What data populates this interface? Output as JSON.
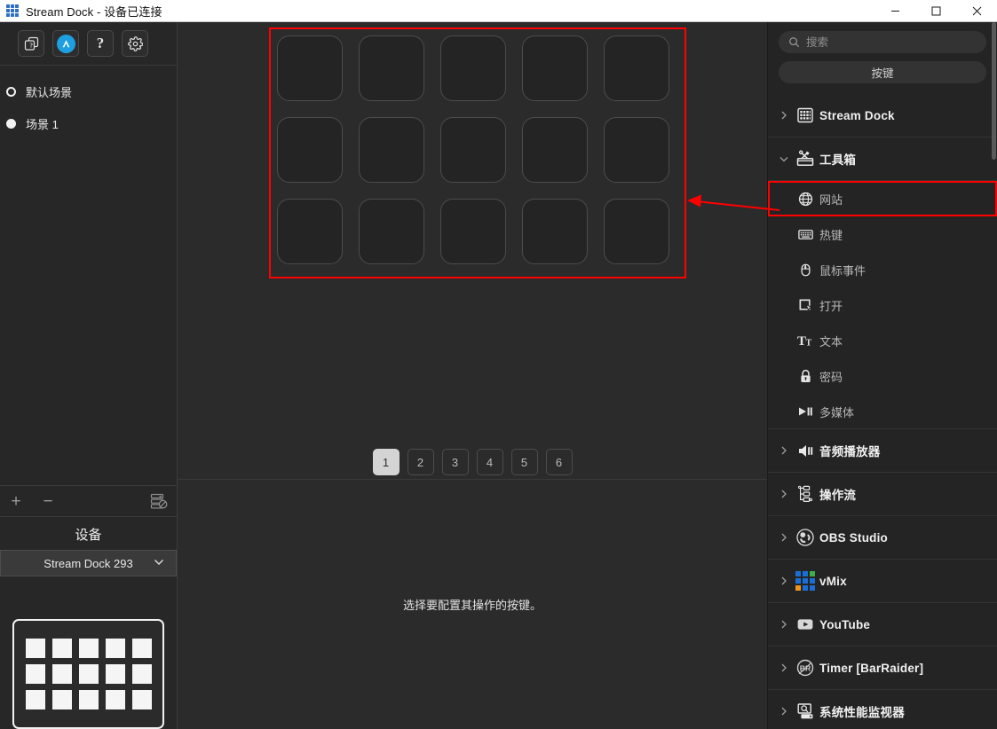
{
  "window": {
    "title": "Stream Dock - 设备已连接",
    "logo_icon": "app-grid-icon",
    "minimize_icon": "minimize-icon",
    "maximize_icon": "maximize-icon",
    "close_icon": "close-icon"
  },
  "toolbar": {
    "buttons": [
      {
        "name": "profiles-button",
        "icon": "stacked-cards-icon",
        "label": ""
      },
      {
        "name": "brand-button",
        "icon": "brand-logo-icon",
        "label": ""
      },
      {
        "name": "help-button",
        "icon": "question-mark-icon",
        "label": "?"
      },
      {
        "name": "settings-button",
        "icon": "gear-icon",
        "label": ""
      }
    ]
  },
  "scenes": {
    "items": [
      {
        "label": "默认场景",
        "selected": true,
        "marker": "ring"
      },
      {
        "label": "场景 1",
        "selected": false,
        "marker": "solid"
      }
    ],
    "actions": {
      "add_label": "+",
      "remove_label": "−",
      "manage_icon": "device-list-icon"
    }
  },
  "device": {
    "heading": "设备",
    "selected": "Stream Dock 293",
    "chevron_icon": "chevron-down-icon",
    "preview_icon": "device-keypad-preview",
    "preview_rows": 3,
    "preview_cols": 5
  },
  "canvas": {
    "grid_rows": 3,
    "grid_cols": 5,
    "keys_total": 15,
    "annotation": {
      "box_color": "#fe0000",
      "arrow_color": "#fe0000",
      "arrow_icon": "left-arrow-annotation"
    },
    "pages": [
      "1",
      "2",
      "3",
      "4",
      "5",
      "6"
    ],
    "active_page": "1",
    "hint": "选择要配置其操作的按键。"
  },
  "right_panel": {
    "search": {
      "placeholder": "搜索",
      "value": "",
      "icon": "search-icon"
    },
    "keys_button": "按键",
    "scrollbar_icon": "vertical-scrollbar",
    "categories": [
      {
        "label": "Stream Dock",
        "icon": "stream-dock-keypad-icon",
        "expanded": false,
        "chevron": "chevron-right-icon",
        "children": []
      },
      {
        "label": "工具箱",
        "icon": "toolbox-icon",
        "expanded": true,
        "chevron": "chevron-down-icon",
        "children": [
          {
            "label": "网站",
            "icon": "globe-icon",
            "selected": true
          },
          {
            "label": "热键",
            "icon": "keyboard-icon",
            "selected": false
          },
          {
            "label": "鼠标事件",
            "icon": "mouse-icon",
            "selected": false
          },
          {
            "label": "打开",
            "icon": "open-cursor-icon",
            "selected": false
          },
          {
            "label": "文本",
            "icon": "text-tt-icon",
            "selected": false
          },
          {
            "label": "密码",
            "icon": "lock-icon",
            "selected": false
          },
          {
            "label": "多媒体",
            "icon": "play-pause-icon",
            "selected": false
          }
        ]
      },
      {
        "label": "音频播放器",
        "icon": "speaker-icon",
        "expanded": false,
        "chevron": "chevron-right-icon",
        "children": []
      },
      {
        "label": "操作流",
        "icon": "workflow-nodes-icon",
        "expanded": false,
        "chevron": "chevron-right-icon",
        "children": []
      },
      {
        "label": "OBS Studio",
        "icon": "obs-studio-icon",
        "expanded": false,
        "chevron": "chevron-right-icon",
        "children": []
      },
      {
        "label": "vMix",
        "icon": "vmix-grid-icon",
        "expanded": false,
        "chevron": "chevron-right-icon",
        "children": []
      },
      {
        "label": "YouTube",
        "icon": "youtube-icon",
        "expanded": false,
        "chevron": "chevron-right-icon",
        "children": []
      },
      {
        "label": "Timer [BarRaider]",
        "icon": "barraider-icon",
        "expanded": false,
        "chevron": "chevron-right-icon",
        "children": []
      },
      {
        "label": "系统性能监视器",
        "icon": "system-monitor-icon",
        "expanded": false,
        "chevron": "chevron-right-icon",
        "children": []
      }
    ]
  },
  "colors": {
    "accent_red": "#fe0000",
    "accent_blue": "#1e9fe0",
    "panel_bg": "#242424",
    "canvas_bg": "#2b2b2b",
    "sidebar_bg": "#272727"
  }
}
